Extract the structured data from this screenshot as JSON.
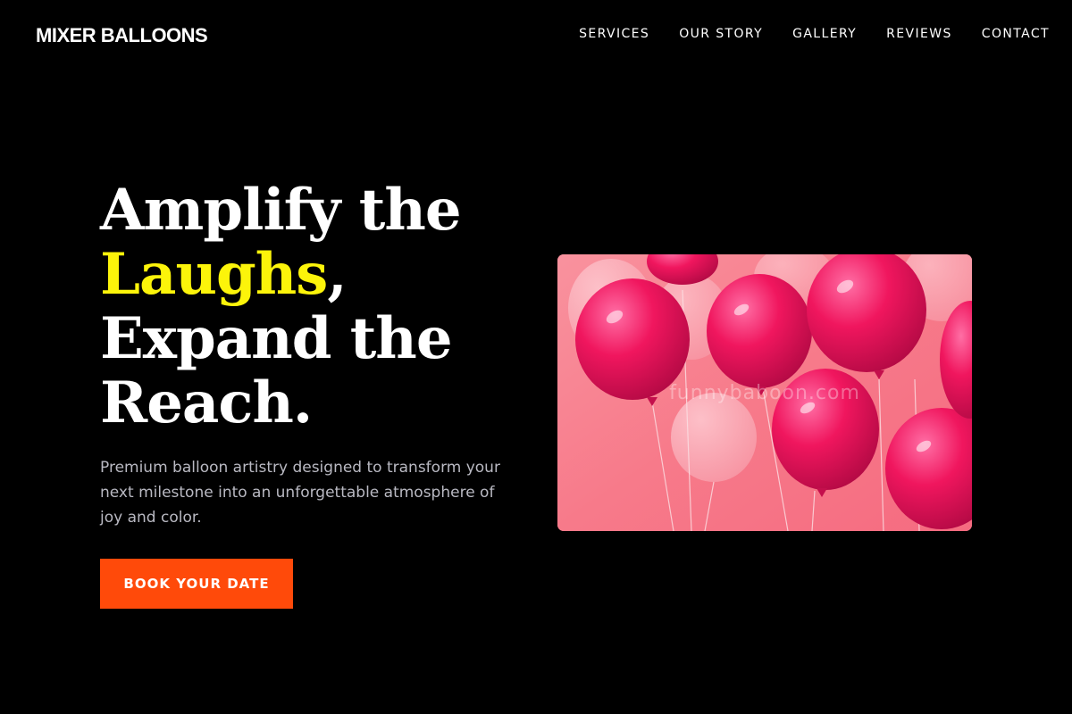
{
  "brand": {
    "name": "MIXER BALLOONS"
  },
  "nav": {
    "items": [
      {
        "label": "SERVICES"
      },
      {
        "label": "OUR STORY"
      },
      {
        "label": "GALLERY"
      },
      {
        "label": "REVIEWS"
      },
      {
        "label": "CONTACT"
      }
    ]
  },
  "hero": {
    "headline": {
      "line1": "Amplify the",
      "highlight": "Laughs",
      "comma": ",",
      "line3": "Expand the",
      "line4": "Reach."
    },
    "subtext": "Premium balloon artistry designed to transform your next milestone into an unforgettable atmosphere of joy and color.",
    "cta_label": "BOOK YOUR DATE",
    "image": {
      "watermark": "funnybaboon.com",
      "icon": "pink-balloons-photo"
    }
  },
  "colors": {
    "background": "#000000",
    "highlight": "#fcf40a",
    "cta": "#ff4a0a",
    "subtext": "#b9b9c2",
    "balloon": "#f0165e"
  }
}
